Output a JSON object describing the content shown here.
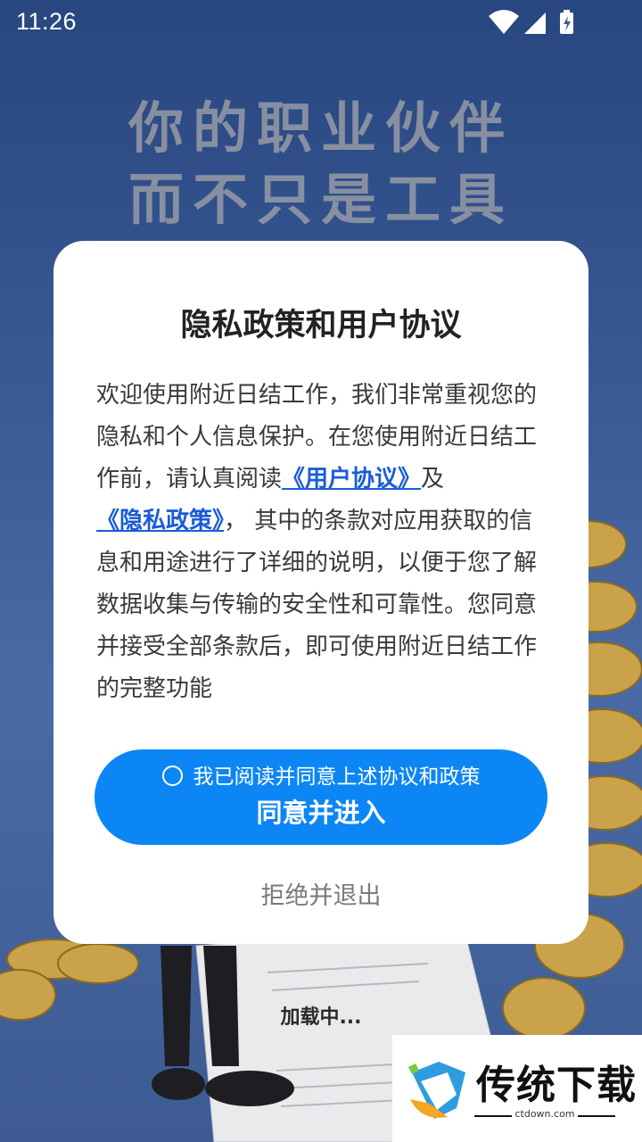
{
  "status_bar": {
    "time": "11:26"
  },
  "background": {
    "headline_line1": "你的职业伙伴",
    "headline_line2": "而不只是工具",
    "loading": "加载中..."
  },
  "dialog": {
    "title": "隐私政策和用户协议",
    "body_intro": "欢迎使用附近日结工作，我们非常重视您的隐私和个人信息保护。在您使用附近日结工作前，请认真阅读",
    "user_agreement_link": "《用户协议》",
    "and_text": "及",
    "privacy_policy_link": "《隐私政策》",
    "body_rest": "， 其中的条款对应用获取的信息和用途进行了详细的说明，以便于您了解数据收集与传输的安全性和可靠性。您同意并接受全部条款后，即可使用附近日结工作的完整功能",
    "consent_checkbox_label": "我已阅读并同意上述协议和政策",
    "agree_button_label": "同意并进入",
    "reject_button_label": "拒绝并退出"
  },
  "watermark": {
    "brand": "传统下载",
    "site": "ctdown.com"
  },
  "colors": {
    "primary_button": "#0c86f5",
    "link": "#1a5cd8"
  }
}
